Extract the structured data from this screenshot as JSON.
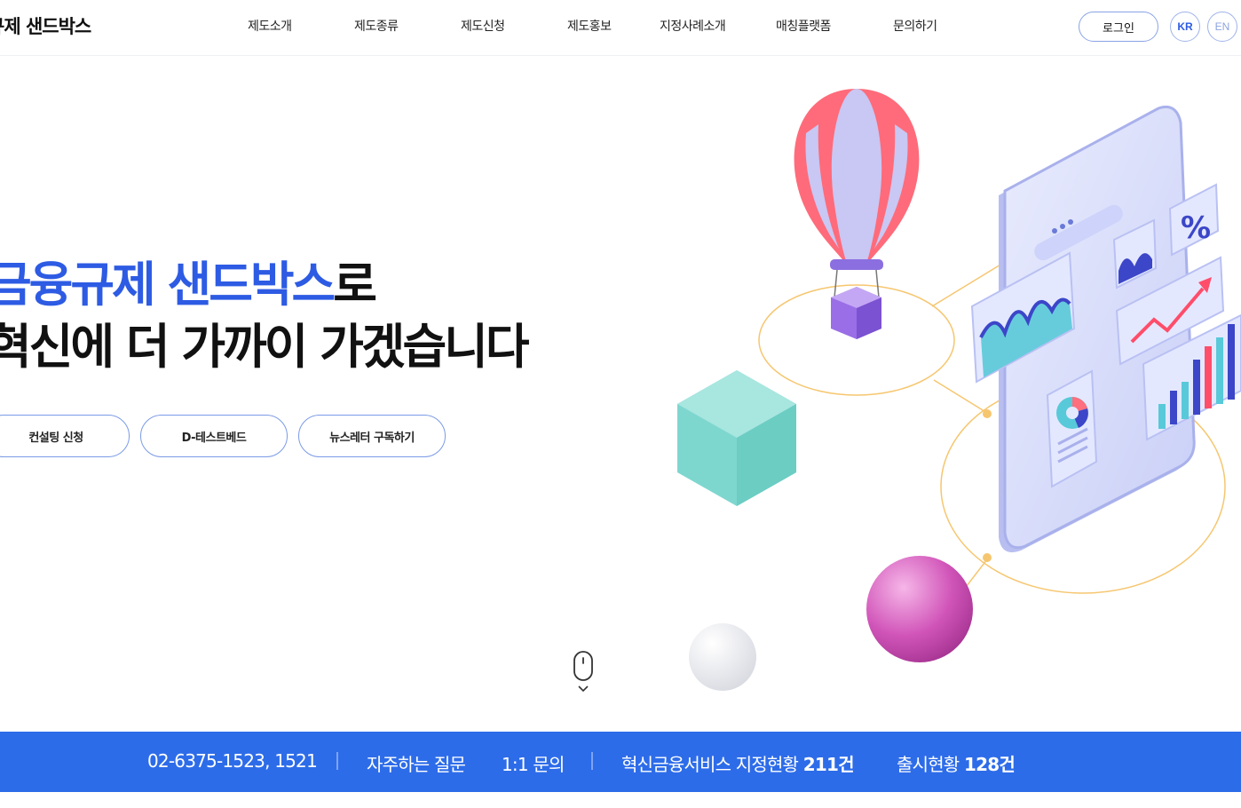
{
  "header": {
    "logo": "규제 샌드박스",
    "nav": [
      {
        "label": "제도소개"
      },
      {
        "label": "제도종류"
      },
      {
        "label": "제도신청"
      },
      {
        "label": "제도홍보"
      },
      {
        "label": "지정사례소개"
      },
      {
        "label": "매칭플랫폼"
      },
      {
        "label": "문의하기"
      }
    ],
    "login": "로그인",
    "lang_kr": "KR",
    "lang_en": "EN"
  },
  "hero": {
    "title_highlight": "금융규제 샌드박스",
    "title_suffix": "로",
    "title_line2": "혁신에 더 가까이 가겠습니다",
    "buttons": [
      {
        "label": "컨설팅 신청"
      },
      {
        "label": "D-테스트베드"
      },
      {
        "label": "뉴스레터 구독하기"
      }
    ]
  },
  "colors": {
    "accent": "#2d5be3",
    "bar": "#2d6ce9"
  },
  "bottom_bar": {
    "phone": "02-6375-1523, 1521",
    "faq": "자주하는 질문",
    "inquiry": "1:1 문의",
    "designated_label": "혁신금융서비스 지정현황",
    "designated_count": "211건",
    "launch_label": "출시현황",
    "launch_count": "128건"
  }
}
